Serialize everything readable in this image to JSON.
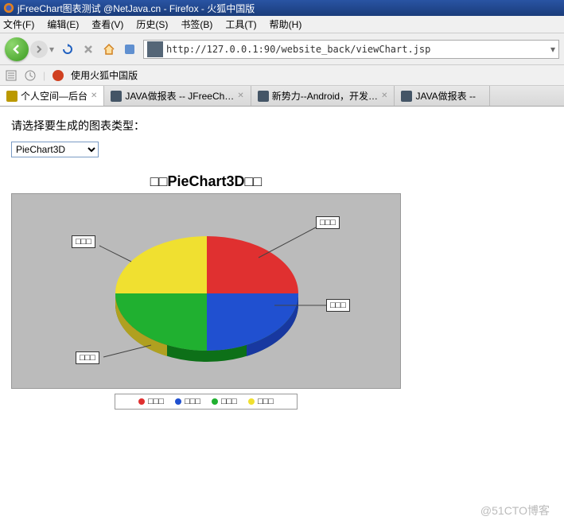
{
  "window": {
    "title": "jFreeChart图表测试 @NetJava.cn - Firefox - 火狐中国版"
  },
  "menu": {
    "file": "文件(F)",
    "edit": "编辑(E)",
    "view": "查看(V)",
    "history": "历史(S)",
    "bookmarks": "书签(B)",
    "tools": "工具(T)",
    "help": "帮助(H)"
  },
  "url": "http://127.0.0.1:90/website_back/viewChart.jsp",
  "bookmark_bar": {
    "label": "使用火狐中国版"
  },
  "tabs": [
    {
      "label": "个人空间—后台",
      "active": true
    },
    {
      "label": "JAVA做报表 -- JFreeCh…",
      "active": false
    },
    {
      "label": "新势力--Android，开发…",
      "active": false
    },
    {
      "label": "JAVA做报表 --",
      "active": false
    }
  ],
  "page": {
    "prompt": "请选择要生成的图表类型：",
    "select_value": "PieChart3D"
  },
  "chart_data": {
    "type": "pie",
    "title": "□□PieChart3D□□",
    "series": [
      {
        "name": "□□□",
        "value": 25,
        "color": "#e03030"
      },
      {
        "name": "□□□",
        "value": 25,
        "color": "#2050d0"
      },
      {
        "name": "□□□",
        "value": 25,
        "color": "#20b030"
      },
      {
        "name": "□□□",
        "value": 25,
        "color": "#f0e030"
      }
    ],
    "callouts": [
      "□□□",
      "□□□",
      "□□□",
      "□□□"
    ],
    "legend": [
      "□□□",
      "□□□",
      "□□□",
      "□□□"
    ]
  },
  "watermark": "@51CTO博客"
}
